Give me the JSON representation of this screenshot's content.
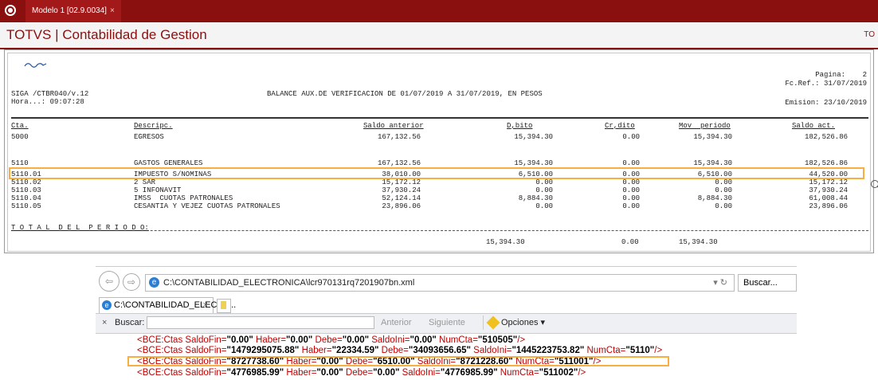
{
  "tabbar": {
    "tab_label": "Modelo 1 [02.9.0034]",
    "close": "×"
  },
  "app": {
    "title": "TOTVS | Contabilidad de Gestion",
    "right": "TO"
  },
  "report": {
    "pagina": "Pagina:    2",
    "fcref": "Fc.Ref.: 31/07/2019",
    "siga": "SIGA /CTBR040/v.12",
    "hora": "Hora...: 09:07:28",
    "titulo": "BALANCE AUX.DE VERIFICACION DE 01/07/2019 A 31/07/2019, EN PESOS",
    "emision": "Emision: 23/10/2019",
    "headers": [
      "Cta.",
      "Descripc.",
      "Saldo anterior",
      "D,bito",
      "Cr,dito",
      "Mov  periodo",
      "Saldo act."
    ],
    "rows": [
      [
        "5000",
        "EGRESOS",
        "167,132.56",
        "15,394.30",
        "0.00",
        "15,394.30",
        "182,526.86"
      ],
      [
        "5110",
        "GASTOS GENERALES",
        "167,132.56",
        "15,394.30",
        "0.00",
        "15,394.30",
        "182,526.86"
      ],
      [
        "5110.01",
        "IMPUESTO S/NOMINAS",
        "38,010.00",
        "6,510.00",
        "0.00",
        "6,510.00",
        "44,520.00"
      ],
      [
        "5110.02",
        "2 SAR",
        "15,172.12",
        "0.00",
        "0.00",
        "0.00",
        "15,172.12"
      ],
      [
        "5110.03",
        "5 INFONAVIT",
        "37,930.24",
        "0.00",
        "0.00",
        "0.00",
        "37,930.24"
      ],
      [
        "5110.04",
        "IMSS  CUOTAS PATRONALES",
        "52,124.14",
        "8,884.30",
        "0.00",
        "8,884.30",
        "61,008.44"
      ],
      [
        "5110.05",
        "CESANTIA Y VEJEZ CUOTAS PATRONALES",
        "23,896.06",
        "0.00",
        "0.00",
        "0.00",
        "23,896.06"
      ]
    ],
    "total_label": "T O T A L  D E L  P E R I O D O:",
    "totals": [
      "15,394.30",
      "0.00",
      "15,394.30"
    ]
  },
  "browser": {
    "address": "C:\\CONTABILIDAD_ELECTRONICA\\lcr970131rq7201907bn.xml",
    "search_placeholder": "Buscar...",
    "tab_label": "C:\\CONTABILIDAD_ELECTR...",
    "find_label": "Buscar:",
    "prev": "Anterior",
    "next": "Siguiente",
    "options": "Opciones ▾",
    "xml_lines": [
      "<BCE:Ctas SaldoFin=\"0.00\" Haber=\"0.00\" Debe=\"0.00\" SaldoIni=\"0.00\" NumCta=\"510505\"/>",
      "<BCE:Ctas SaldoFin=\"1479295075.88\" Haber=\"22334.59\" Debe=\"34093656.65\" SaldoIni=\"1445223753.82\" NumCta=\"5110\"/>",
      "<BCE:Ctas SaldoFin=\"8727738.60\" Haber=\"0.00\" Debe=\"6510.00\" SaldoIni=\"8721228.60\" NumCta=\"511001\"/>",
      "<BCE:Ctas SaldoFin=\"4776985.99\" Haber=\"0.00\" Debe=\"0.00\" SaldoIni=\"4776985.99\" NumCta=\"511002\"/>"
    ]
  },
  "colors": {
    "brand": "#8a1010",
    "highlight": "#f5b041",
    "xml_tag": "#c00000"
  }
}
